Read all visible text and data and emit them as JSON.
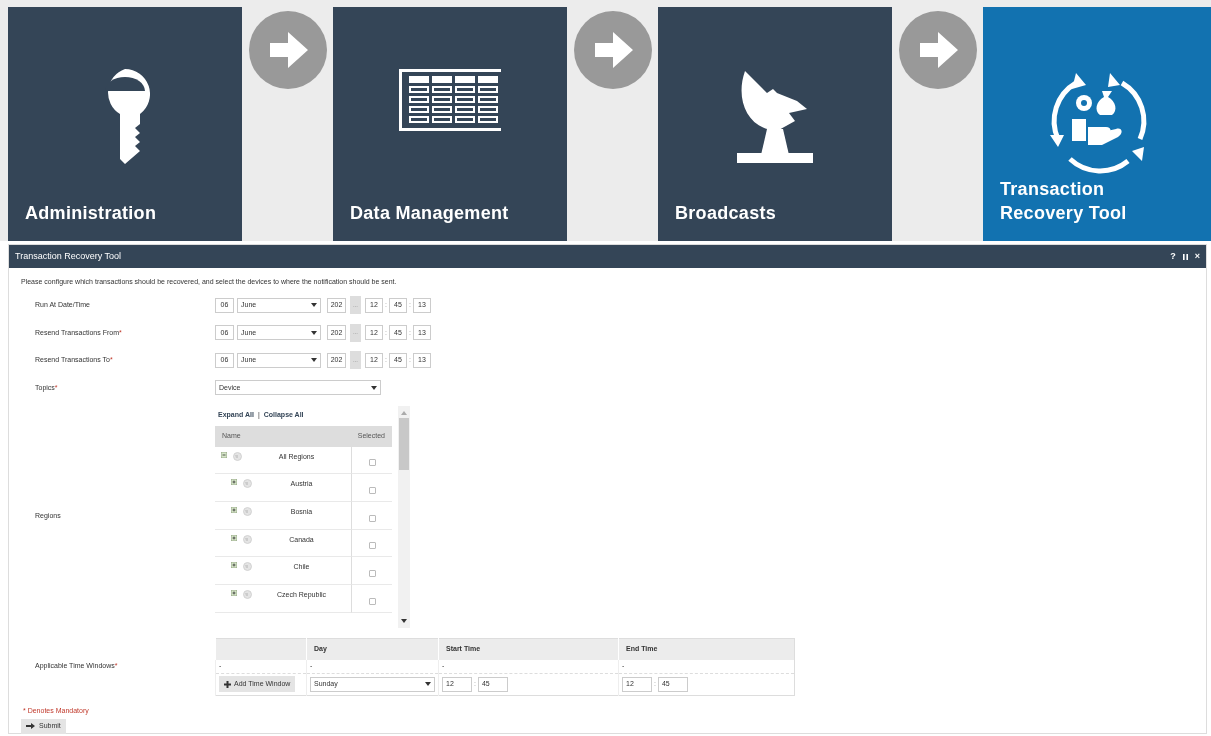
{
  "tiles": [
    {
      "label": "Administration",
      "kind": "key",
      "selected": false
    },
    {
      "label": "Data Management",
      "kind": "table",
      "selected": false
    },
    {
      "label": "Broadcasts",
      "kind": "dish",
      "selected": false
    },
    {
      "label": "Transaction Recovery Tool",
      "kind": "recovery",
      "selected": true
    }
  ],
  "panel": {
    "title": "Transaction Recovery Tool",
    "help": "?",
    "close": "×"
  },
  "intro": "Please configure which transactions should be recovered, and select the devices to where the notification should be sent.",
  "datetime_rows": [
    {
      "label": "Run At Date/Time",
      "day": "06",
      "month": "June",
      "year": "202",
      "picker": "...",
      "hour": "12",
      "minute": "45",
      "second": "13",
      "separators": [
        ":",
        ":"
      ]
    },
    {
      "label": "Resend Transactions From",
      "required_mark": "*",
      "day": "06",
      "month": "June",
      "year": "202",
      "picker": "...",
      "hour": "12",
      "minute": "45",
      "second": "13",
      "separators": [
        ":",
        ":"
      ]
    },
    {
      "label": "Resend Transactions To",
      "required_mark": "*",
      "day": "06",
      "month": "June",
      "year": "202",
      "picker": "...",
      "hour": "12",
      "minute": "45",
      "second": "13",
      "separators": [
        ":",
        ":"
      ]
    }
  ],
  "topics": {
    "label": "Topics",
    "required_mark": "*",
    "value": "Device"
  },
  "regions": {
    "label": "Regions",
    "links": [
      "Expand All",
      "Collapse All"
    ],
    "divider": "|",
    "columns": [
      "Name",
      "Selected"
    ],
    "tree": [
      {
        "name": "All Regions",
        "expanded": true,
        "selected": false,
        "children": [
          {
            "name": "Austria",
            "expanded": false,
            "selected": false
          },
          {
            "name": "Bosnia",
            "expanded": false,
            "selected": false
          },
          {
            "name": "Canada",
            "expanded": false,
            "selected": false
          },
          {
            "name": "Chile",
            "expanded": false,
            "selected": false
          },
          {
            "name": "Czech Republic",
            "expanded": false,
            "selected": false
          }
        ]
      }
    ]
  },
  "time_windows": {
    "label": "Applicable Time Windows",
    "required_mark": "*",
    "columns": [
      "Day",
      "Start Time",
      "End Time"
    ],
    "dash_row": [
      "-",
      "-",
      "-",
      "-"
    ],
    "add_button": "Add Time Window",
    "day": "Sunday",
    "start": [
      "12",
      "45"
    ],
    "end": [
      "12",
      "45"
    ],
    "separators": [
      ":",
      ":"
    ]
  },
  "mandatory_note": "* Denotes Mandatory",
  "submit": "Submit"
}
